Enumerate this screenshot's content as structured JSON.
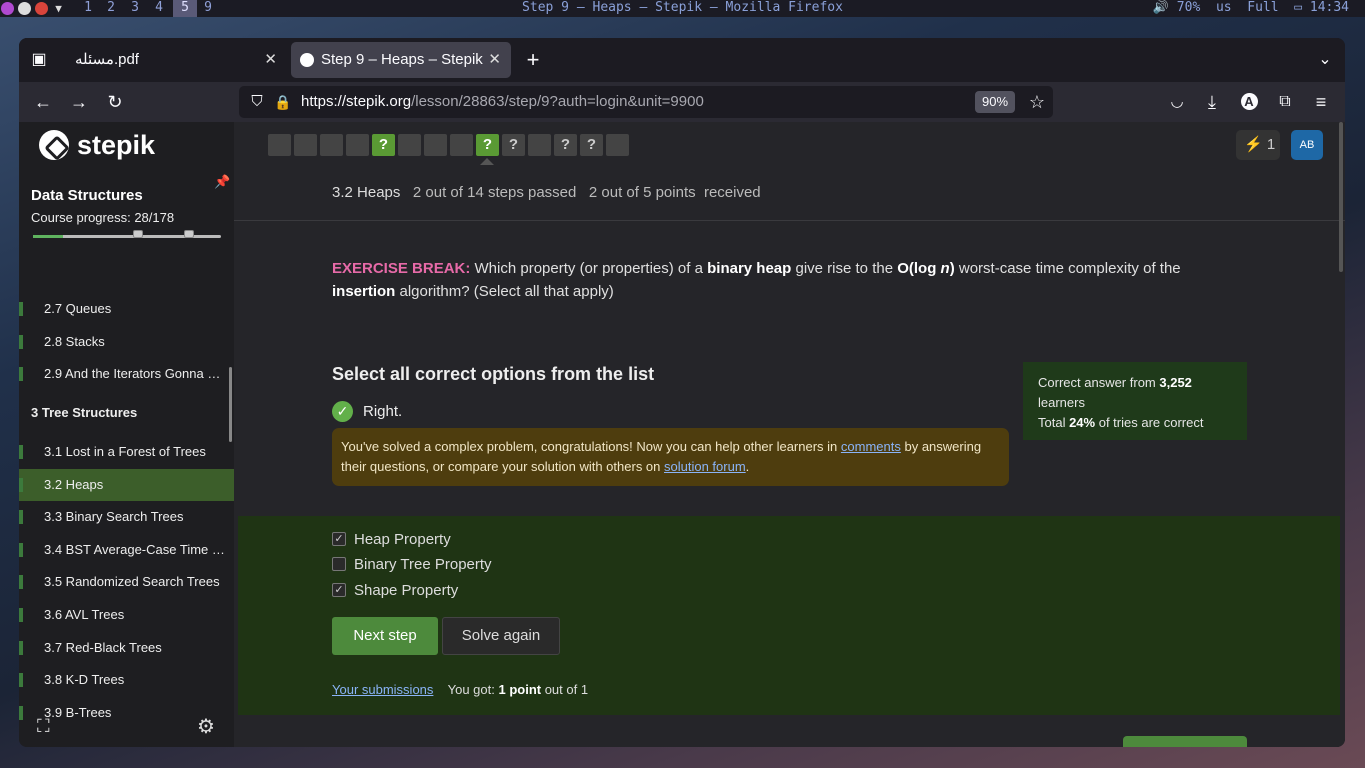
{
  "topbar": {
    "workspaces": [
      "1",
      "2",
      "3",
      "4",
      "5",
      "9"
    ],
    "active_workspace": "5",
    "window_title": "Step 9 – Heaps – Stepik — Mozilla Firefox",
    "status": "🔊 70%  us  Full  ▭ 14:34"
  },
  "browser": {
    "tabs": [
      {
        "label": "مسئله.pdf"
      },
      {
        "label": "Step 9 – Heaps – Stepik"
      }
    ],
    "url_host": "https://stepik.org",
    "url_path": "/lesson/28863/step/9?auth=login&unit=9900",
    "zoom": "90%"
  },
  "sidebar": {
    "logo": "stepik",
    "course_title": "Data Structures",
    "progress_label": "Course progress:  28/178",
    "progress_fraction": 0.157,
    "items": [
      {
        "label": "2.7  Queues",
        "type": "lesson"
      },
      {
        "label": "2.8  Stacks",
        "type": "lesson"
      },
      {
        "label": "2.9  And the Iterators Gonna …",
        "type": "lesson"
      },
      {
        "label": "3  Tree Structures",
        "type": "section"
      },
      {
        "label": "3.1  Lost in a Forest of Trees",
        "type": "lesson"
      },
      {
        "label": "3.2  Heaps",
        "type": "current"
      },
      {
        "label": "3.3  Binary Search Trees",
        "type": "lesson"
      },
      {
        "label": "3.4  BST Average-Case Time …",
        "type": "lesson"
      },
      {
        "label": "3.5  Randomized Search Trees",
        "type": "lesson"
      },
      {
        "label": "3.6  AVL Trees",
        "type": "lesson"
      },
      {
        "label": "3.7  Red-Black Trees",
        "type": "lesson"
      },
      {
        "label": "3.8  K-D Trees",
        "type": "lesson"
      },
      {
        "label": "3.9  B-Trees",
        "type": "lesson"
      }
    ]
  },
  "steps": [
    {
      "label": "",
      "state": "plain"
    },
    {
      "label": "",
      "state": "plain"
    },
    {
      "label": "",
      "state": "plain"
    },
    {
      "label": "",
      "state": "plain"
    },
    {
      "label": "?",
      "state": "passed"
    },
    {
      "label": "",
      "state": "plain"
    },
    {
      "label": "",
      "state": "plain"
    },
    {
      "label": "",
      "state": "plain"
    },
    {
      "label": "?",
      "state": "passed-current"
    },
    {
      "label": "?",
      "state": "plain"
    },
    {
      "label": "",
      "state": "plain"
    },
    {
      "label": "?",
      "state": "plain"
    },
    {
      "label": "?",
      "state": "plain"
    },
    {
      "label": "",
      "state": "plain"
    }
  ],
  "header": {
    "streak": "1",
    "avatar": "AB",
    "lesson": "3.2 Heaps",
    "steps_passed": "2 out of 14 steps passed",
    "points": "2 out of 5 points  received"
  },
  "question": {
    "lead": "EXERCISE BREAK:",
    "t1": " Which property (or properties) of a ",
    "b1": "binary heap",
    "t2": " give rise to the ",
    "b2": "O(log ",
    "b2i": "n",
    "b2e": ")",
    "t3": " worst-case time complexity of the ",
    "b3": "insertion",
    "t4": " algorithm? (Select all that apply)"
  },
  "quiz": {
    "heading": "Select all correct options from the list",
    "result": "Right.",
    "notice_1": "You've solved a complex problem, congratulations! Now you can help other learners in ",
    "notice_link1": "comments",
    "notice_2": " by answering their questions, or compare your solution with others on ",
    "notice_link2": "solution forum",
    "notice_3": ".",
    "options": [
      {
        "label": "Heap Property",
        "checked": true
      },
      {
        "label": "Binary Tree Property",
        "checked": false
      },
      {
        "label": "Shape Property",
        "checked": true
      }
    ],
    "next_label": "Next step",
    "again_label": "Solve again",
    "submissions_label": "Your submissions",
    "got_prefix": "You got: ",
    "got_bold": "1 point",
    "got_suffix": " out of 1"
  },
  "stats": {
    "line1_prefix": "Correct answer from ",
    "learners_count": "3,252",
    "line1_suffix": " learners",
    "line2_prefix": "Total ",
    "percent": "24%",
    "line2_suffix": " of tries are correct"
  },
  "colors": {
    "accent_green": "#5a9a34",
    "exercise_pink": "#e76aa8",
    "avatar_blue": "#1e68a6"
  }
}
